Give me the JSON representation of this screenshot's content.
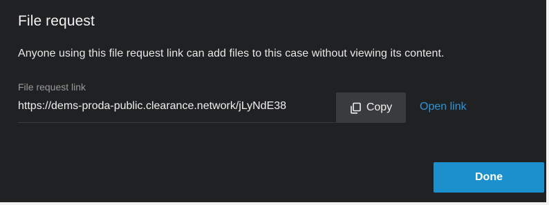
{
  "dialog": {
    "title": "File request",
    "description": "Anyone using this file request link can add files to this case without viewing its content.",
    "link_field": {
      "label": "File request link",
      "value": "https://dems-proda-public.clearance.network/jLyNdE38"
    },
    "copy_button": {
      "icon": "copy-icon",
      "label": "Copy"
    },
    "open_link_label": "Open link",
    "done_label": "Done"
  },
  "colors": {
    "background": "#202123",
    "accent": "#1b90cc",
    "link": "#2f95d6",
    "copy_button_bg": "#3a3b3d"
  }
}
